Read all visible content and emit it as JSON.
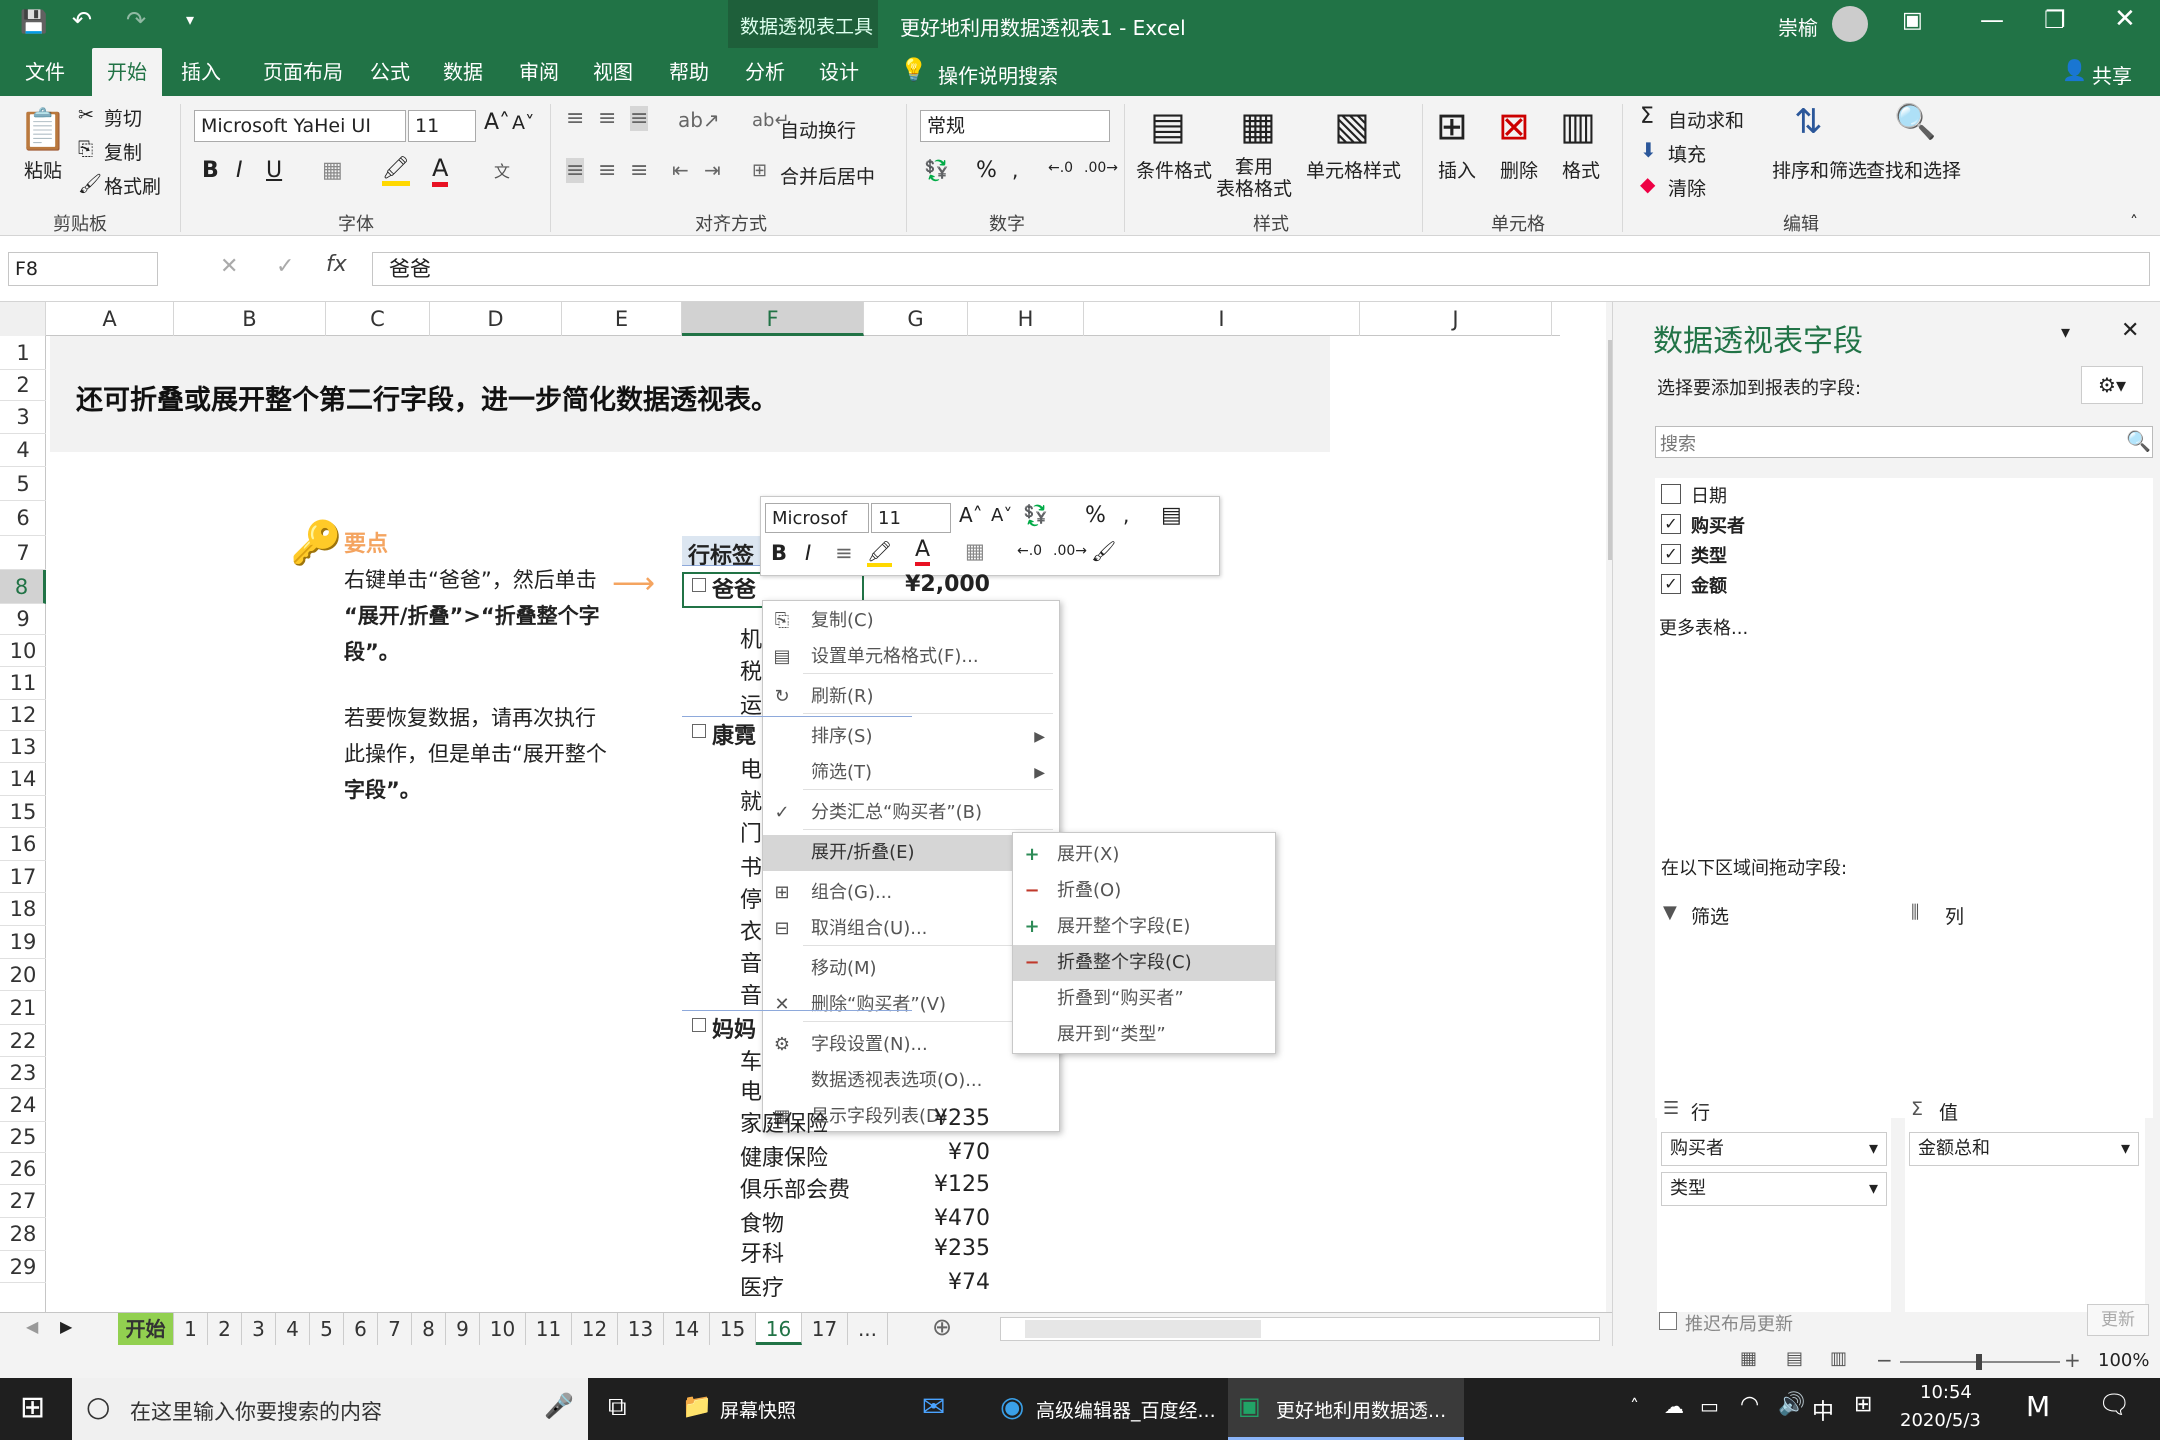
{
  "app": {
    "title": "更好地利用数据透视表1 - Excel",
    "context_tool": "数据透视表工具",
    "user": "崇榆"
  },
  "ribbon_tabs": [
    "文件",
    "开始",
    "插入",
    "页面布局",
    "公式",
    "数据",
    "审阅",
    "视图",
    "帮助",
    "分析",
    "设计"
  ],
  "tell_me": "操作说明搜索",
  "share": "共享",
  "ribbon": {
    "clipboard": {
      "paste": "粘贴",
      "cut": "剪切",
      "copy": "复制",
      "format_painter": "格式刷",
      "label": "剪贴板"
    },
    "font": {
      "name": "Microsoft YaHei UI",
      "size": "11",
      "label": "字体",
      "bold": "B",
      "italic": "I",
      "underline": "U"
    },
    "alignment": {
      "wrap": "自动换行",
      "merge": "合并后居中",
      "label": "对齐方式"
    },
    "number": {
      "format": "常规",
      "label": "数字",
      "percent": "%"
    },
    "styles": {
      "conditional": "条件格式",
      "table": "套用\n表格格式",
      "cell": "单元格样式",
      "label": "样式"
    },
    "cells": {
      "insert": "插入",
      "delete": "删除",
      "format": "格式",
      "label": "单元格"
    },
    "editing": {
      "autosum": "自动求和",
      "fill": "填充",
      "clear": "清除",
      "sort": "排序和筛选",
      "find": "查找和选择",
      "label": "编辑"
    }
  },
  "formula_bar": {
    "namebox": "F8",
    "content": "爸爸",
    "fx": "fx"
  },
  "columns": [
    "A",
    "B",
    "C",
    "D",
    "E",
    "F",
    "G",
    "H",
    "I",
    "J"
  ],
  "rows": [
    "1",
    "2",
    "3",
    "4",
    "5",
    "6",
    "7",
    "8",
    "9",
    "10",
    "11",
    "12",
    "13",
    "14",
    "15",
    "16",
    "17",
    "18",
    "19",
    "20",
    "21",
    "22",
    "23",
    "24",
    "25",
    "26",
    "27",
    "28",
    "29"
  ],
  "sheet": {
    "heading": "还可折叠或展开整个第二行字段，进一步简化数据透视表。",
    "tip_title": "要点",
    "tip_p1a": "右键单击“爸爸”，然后单击",
    "tip_p1b": "“展开/折叠”>“折叠整个字",
    "tip_p1c": "段”。",
    "tip_p2a": "若要恢复数据，请再次执行",
    "tip_p2b": "此操作，但是单击“展开整个",
    "tip_p2c": "字段”。",
    "pivot_header": "行标签",
    "pivot_rows": [
      {
        "label": "爸爸",
        "value": "¥2,000",
        "bold": true,
        "group": true
      },
      {
        "label": "机",
        "value": ""
      },
      {
        "label": "税",
        "value": ""
      },
      {
        "label": "运",
        "value": ""
      },
      {
        "label": "康霓",
        "value": "",
        "bold": true,
        "group": true
      },
      {
        "label": "电",
        "value": ""
      },
      {
        "label": "就",
        "value": ""
      },
      {
        "label": "门",
        "value": ""
      },
      {
        "label": "书",
        "value": ""
      },
      {
        "label": "停",
        "value": ""
      },
      {
        "label": "衣",
        "value": ""
      },
      {
        "label": "音",
        "value": ""
      },
      {
        "label": "音",
        "value": ""
      },
      {
        "label": "妈妈",
        "value": "",
        "bold": true,
        "group": true
      },
      {
        "label": "车",
        "value": ""
      },
      {
        "label": "电",
        "value": ""
      },
      {
        "label": "家庭保险",
        "value": "¥235"
      },
      {
        "label": "健康保险",
        "value": "¥70"
      },
      {
        "label": "俱乐部会费",
        "value": "¥125"
      },
      {
        "label": "食物",
        "value": "¥470"
      },
      {
        "label": "牙科",
        "value": "¥235"
      },
      {
        "label": "医疗",
        "value": "¥74"
      }
    ]
  },
  "mini_toolbar": {
    "font": "Microsof",
    "size": "11",
    "percent": "%"
  },
  "context_menu": [
    {
      "label": "复制(C)",
      "icon": "copy-icon"
    },
    {
      "label": "设置单元格格式(F)...",
      "icon": "format-cells-icon"
    },
    {
      "label": "刷新(R)",
      "icon": "refresh-icon"
    },
    {
      "label": "排序(S)",
      "submenu": true
    },
    {
      "label": "筛选(T)",
      "submenu": true
    },
    {
      "label": "分类汇总“购买者”(B)",
      "icon": "check-icon"
    },
    {
      "label": "展开/折叠(E)",
      "submenu": true,
      "highlight": true
    },
    {
      "label": "组合(G)...",
      "icon": "group-icon"
    },
    {
      "label": "取消组合(U)...",
      "icon": "ungroup-icon"
    },
    {
      "label": "移动(M)",
      "submenu": true
    },
    {
      "label": "删除“购买者”(V)",
      "icon": "delete-icon"
    },
    {
      "label": "字段设置(N)...",
      "icon": "field-settings-icon"
    },
    {
      "label": "数据透视表选项(O)...",
      "icon": ""
    },
    {
      "label": "显示字段列表(D)",
      "icon": "field-list-icon"
    }
  ],
  "submenu": [
    {
      "label": "展开(X)",
      "icon": "expand-icon"
    },
    {
      "label": "折叠(O)",
      "icon": "collapse-icon"
    },
    {
      "label": "展开整个字段(E)",
      "icon": "expand-field-icon"
    },
    {
      "label": "折叠整个字段(C)",
      "icon": "collapse-field-icon",
      "highlight": true
    },
    {
      "label": "折叠到“购买者”",
      "icon": ""
    },
    {
      "label": "展开到“类型”",
      "icon": ""
    }
  ],
  "pane": {
    "title": "数据透视表字段",
    "subtitle": "选择要添加到报表的字段:",
    "search_placeholder": "搜索",
    "fields": [
      {
        "label": "日期",
        "checked": false
      },
      {
        "label": "购买者",
        "checked": true
      },
      {
        "label": "类型",
        "checked": true
      },
      {
        "label": "金额",
        "checked": true
      }
    ],
    "more_tables": "更多表格...",
    "drag_label": "在以下区域间拖动字段:",
    "filter": "筛选",
    "columns": "列",
    "rows": "行",
    "values": "值",
    "row_items": [
      "购买者",
      "类型"
    ],
    "value_items": [
      "金额总和"
    ],
    "defer": "推迟布局更新",
    "update": "更新"
  },
  "sheet_tabs": [
    "开始",
    "1",
    "2",
    "3",
    "4",
    "5",
    "6",
    "7",
    "8",
    "9",
    "10",
    "11",
    "12",
    "13",
    "14",
    "15",
    "16",
    "17",
    "..."
  ],
  "status": {
    "zoom": "100%"
  },
  "taskbar": {
    "search": "在这里输入你要搜索的内容",
    "apps": [
      "屏幕快照",
      "高级编辑器_百度经...",
      "更好地利用数据透..."
    ],
    "time": "10:54",
    "date": "2020/5/3",
    "ime": "中"
  },
  "colors": {
    "excel_green": "#217346",
    "highlight": "#d6d6d6",
    "pane_bg": "#f3f3f3"
  }
}
